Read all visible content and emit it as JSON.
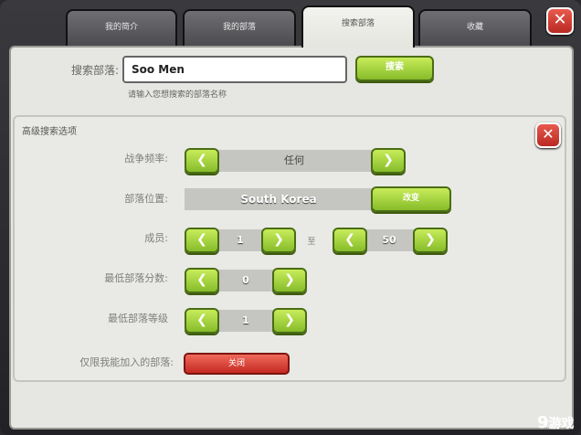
{
  "tabs": [
    {
      "label": "我的简介"
    },
    {
      "label": "我的部落"
    },
    {
      "label": "搜索部落"
    },
    {
      "label": "收藏"
    }
  ],
  "search": {
    "label": "搜索部落:",
    "value": "Soo Men",
    "button": "搜索",
    "hint": "请输入您想搜索的部落名称"
  },
  "advanced": {
    "title": "高级搜索选项",
    "war_frequency": {
      "label": "战争频率:",
      "value": "任何"
    },
    "location": {
      "label": "部落位置:",
      "value": "South Korea",
      "button": "改变"
    },
    "members": {
      "label": "成员:",
      "min": "1",
      "to": "至",
      "max": "50"
    },
    "min_points": {
      "label": "最低部落分数:",
      "value": "0"
    },
    "min_level": {
      "label": "最低部落等级",
      "value": "1"
    },
    "joinable_only": {
      "label": "仅限我能加入的部落:",
      "value": "关闭"
    }
  },
  "icons": {
    "close": "close-icon",
    "left": "chevron-left-icon",
    "right": "chevron-right-icon"
  },
  "colors": {
    "green": "#86bc2a",
    "red": "#c42a22",
    "panel": "#e6e6e2"
  },
  "watermark": {
    "num": "9",
    "text": "游戏"
  }
}
